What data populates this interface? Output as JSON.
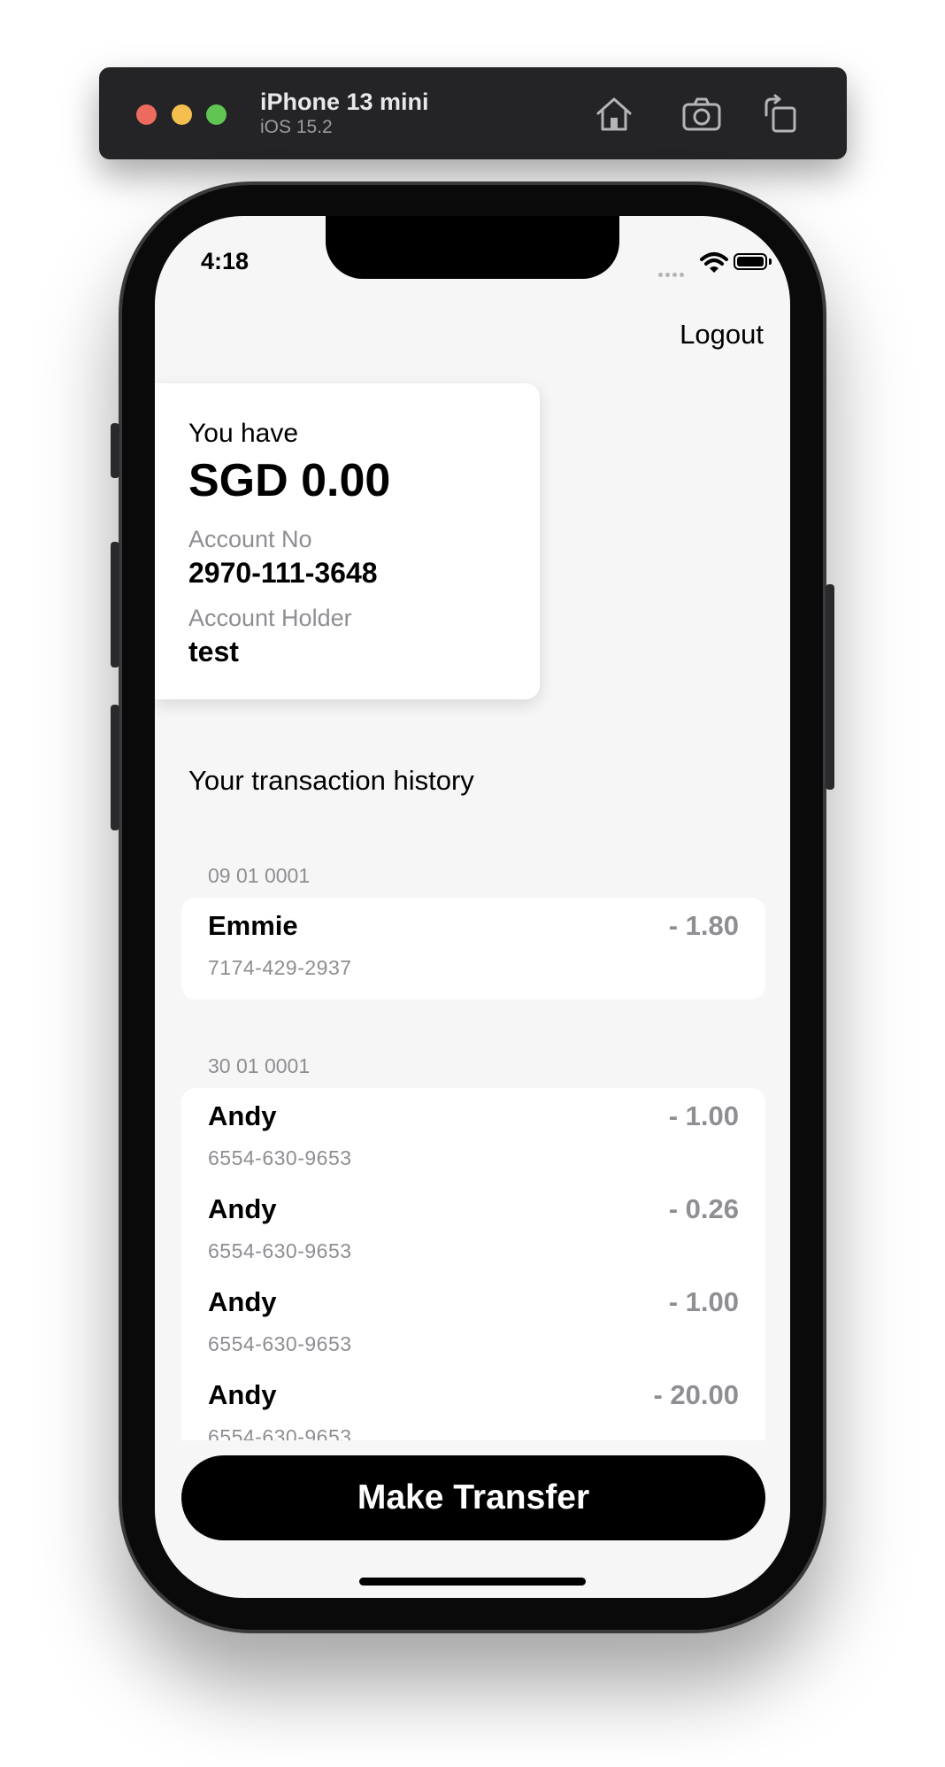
{
  "simulator": {
    "device_name": "iPhone 13 mini",
    "os_version": "iOS 15.2",
    "icons": [
      "home-icon",
      "screenshot-icon",
      "rotate-icon"
    ]
  },
  "status_bar": {
    "time": "4:18"
  },
  "header": {
    "logout_label": "Logout"
  },
  "balance_card": {
    "heading": "You have",
    "amount": "SGD 0.00",
    "account_no_label": "Account No",
    "account_no": "2970-111-3648",
    "holder_label": "Account Holder",
    "holder": "test"
  },
  "history": {
    "title": "Your transaction history",
    "groups": [
      {
        "date": "09 01 0001",
        "transactions": [
          {
            "name": "Emmie",
            "account": "7174-429-2937",
            "amount": "- 1.80"
          }
        ]
      },
      {
        "date": "30 01 0001",
        "transactions": [
          {
            "name": "Andy",
            "account": "6554-630-9653",
            "amount": "- 1.00"
          },
          {
            "name": "Andy",
            "account": "6554-630-9653",
            "amount": "- 0.26"
          },
          {
            "name": "Andy",
            "account": "6554-630-9653",
            "amount": "- 1.00"
          },
          {
            "name": "Andy",
            "account": "6554-630-9653",
            "amount": "- 20.00"
          }
        ]
      }
    ]
  },
  "actions": {
    "transfer_label": "Make Transfer"
  },
  "colors": {
    "screen_background": "#f6f6f6",
    "card_background": "#ffffff",
    "muted_text": "#8e8e93",
    "button_background": "#000000"
  }
}
